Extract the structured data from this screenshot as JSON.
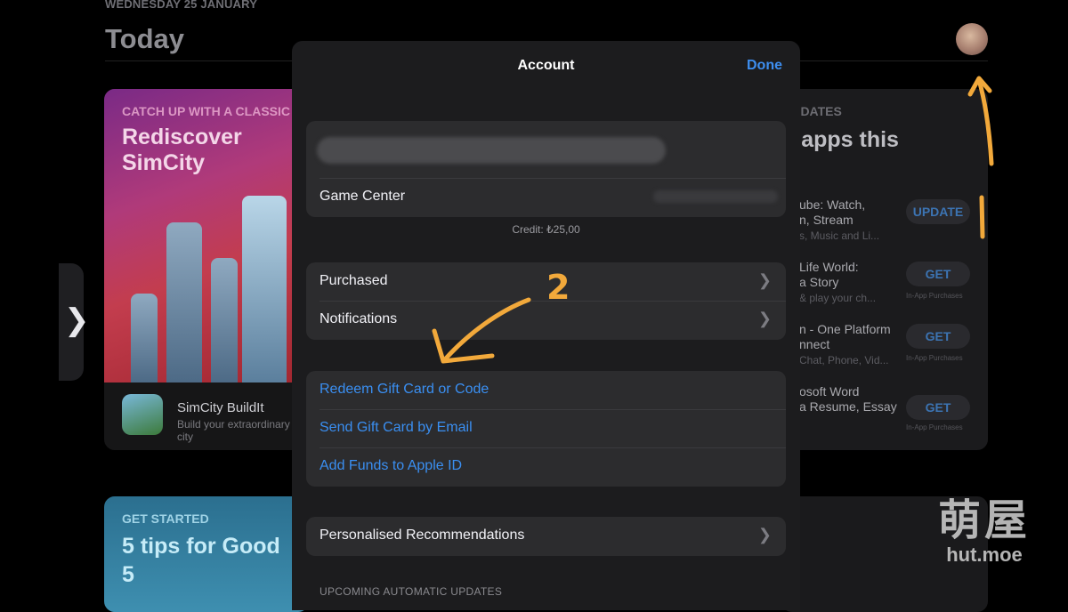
{
  "background": {
    "date": "WEDNESDAY 25 JANUARY",
    "title": "Today",
    "left_card": {
      "eyebrow": "CATCH UP WITH A CLASSIC",
      "headline": "Rediscover SimCity",
      "app_name": "SimCity BuildIt",
      "app_sub": "Build your extraordinary city"
    },
    "right_card": {
      "eyebrow": "UPDATES",
      "headline": "d apps this",
      "items": [
        {
          "line1": "ube: Watch,",
          "line2": "n, Stream",
          "line3": "s, Music and Li...",
          "button": "UPDATE",
          "iap": ""
        },
        {
          "line1": "Life World:",
          "line2": "a Story",
          "line3": "& play your ch...",
          "button": "GET",
          "iap": "In-App Purchases"
        },
        {
          "line1": "n - One Platform",
          "line2": "nnect",
          "line3": "Chat, Phone, Vid...",
          "button": "GET",
          "iap": "In-App Purchases"
        },
        {
          "line1": "osoft Word",
          "line2": "a Resume, Essay",
          "line3": "",
          "button": "GET",
          "iap": "In-App Purchases"
        }
      ]
    },
    "bottom_left_card": {
      "eyebrow": "GET STARTED",
      "headline_line1": "5 tips for Good",
      "headline_line2": "5"
    }
  },
  "sheet": {
    "title": "Account",
    "done": "Done",
    "game_center": "Game Center",
    "credit": "Credit: ₺25,00",
    "purchased": "Purchased",
    "notifications": "Notifications",
    "redeem": "Redeem Gift Card or Code",
    "send_gift": "Send Gift Card by Email",
    "add_funds": "Add Funds to Apple ID",
    "personalised": "Personalised Recommendations",
    "upcoming": "UPCOMING AUTOMATIC UPDATES"
  },
  "annotations": {
    "step_number": "2",
    "color": "#f2a93b"
  },
  "watermark": {
    "cn": "萌屋",
    "site": "hut.moe"
  }
}
